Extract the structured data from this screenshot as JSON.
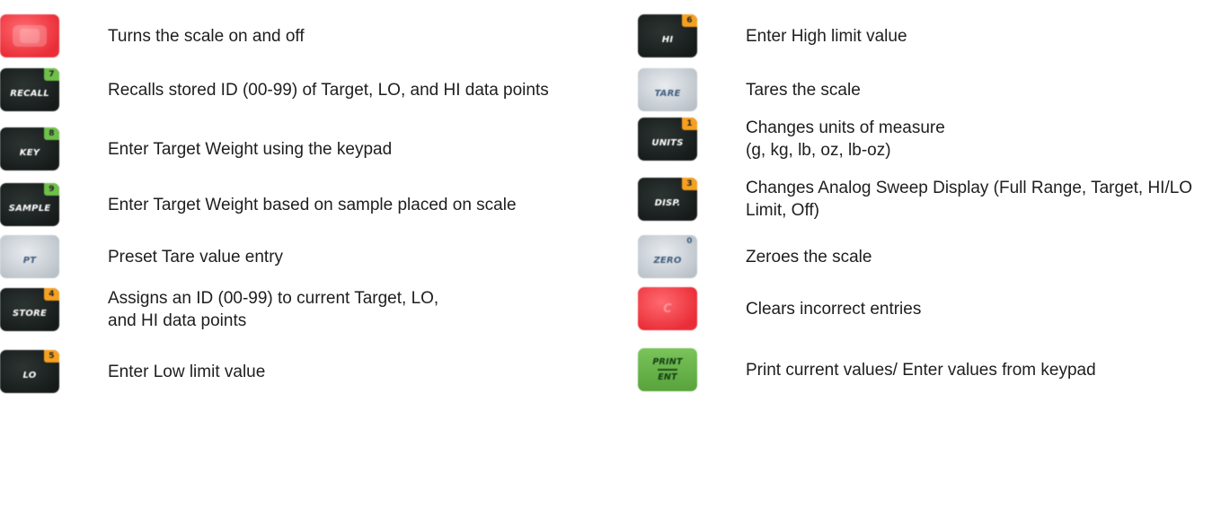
{
  "left": [
    {
      "key": "power",
      "style": "red",
      "caption": "",
      "number": "",
      "text": "Turns the scale on and off"
    },
    {
      "key": "recall",
      "style": "dark",
      "caption": "RECALL",
      "number": "7",
      "text": "Recalls stored ID (00-99) of Target, LO, and HI data points"
    },
    {
      "key": "key",
      "style": "dark",
      "caption": "KEY",
      "number": "8",
      "text": "Enter Target Weight using the keypad"
    },
    {
      "key": "sample",
      "style": "dark",
      "caption": "SAMPLE",
      "number": "9",
      "text": "Enter Target Weight based on sample placed on scale"
    },
    {
      "key": "pt",
      "style": "silver",
      "caption": "PT",
      "number": "",
      "text": "Preset Tare value entry"
    },
    {
      "key": "store",
      "style": "dark",
      "caption": "STORE",
      "number": "4",
      "text": "Assigns an ID (00-99) to current Target, LO,\nand HI data points"
    },
    {
      "key": "lo",
      "style": "dark",
      "caption": "LO",
      "number": "5",
      "text": "Enter Low limit value"
    }
  ],
  "right": [
    {
      "key": "hi",
      "style": "dark",
      "caption": "HI",
      "number": "6",
      "text": "Enter High limit value"
    },
    {
      "key": "tare",
      "style": "silver",
      "caption": "TARE",
      "number": "",
      "text": "Tares the scale"
    },
    {
      "key": "units",
      "style": "dark",
      "caption": "UNITS",
      "number": "1",
      "text": "Changes units of measure\n(g, kg, lb, oz, lb-oz)"
    },
    {
      "key": "disp",
      "style": "dark",
      "caption": "DISP.",
      "number": "3",
      "text": "Changes Analog Sweep Display (Full Range, Target, HI/LO Limit, Off)"
    },
    {
      "key": "zero",
      "style": "silver",
      "caption": "ZERO",
      "number": "0",
      "text": "Zeroes the scale"
    },
    {
      "key": "clear",
      "style": "red",
      "caption": "C",
      "number": "",
      "text": "Clears incorrect entries"
    },
    {
      "key": "print",
      "style": "green",
      "caption": "PRINT",
      "caption2": "ENT",
      "number": "",
      "text": "Print current values/ Enter values from keypad"
    }
  ],
  "colors": {
    "dark_key": "#1b2120",
    "silver_key": "#c4cbd2",
    "red_key": "#ef3a44",
    "green_key": "#62ad44",
    "number_green": "#6fbf4b",
    "number_orange": "#f5a01f"
  }
}
